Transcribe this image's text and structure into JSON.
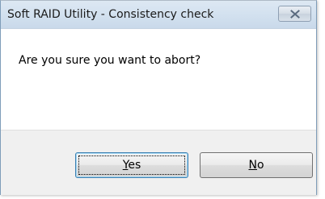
{
  "window": {
    "title": "Soft RAID Utility - Consistency check",
    "close_icon": "close-icon"
  },
  "message": "Are you sure you want to abort?",
  "buttons": {
    "yes": {
      "mnemonic": "Y",
      "rest": "es",
      "focused": true
    },
    "no": {
      "mnemonic": "N",
      "rest": "o",
      "focused": false
    }
  },
  "colors": {
    "titlebar": "#d4e2f0",
    "footer": "#f0f0f0",
    "focused_button_border": "#3c7fb1"
  }
}
